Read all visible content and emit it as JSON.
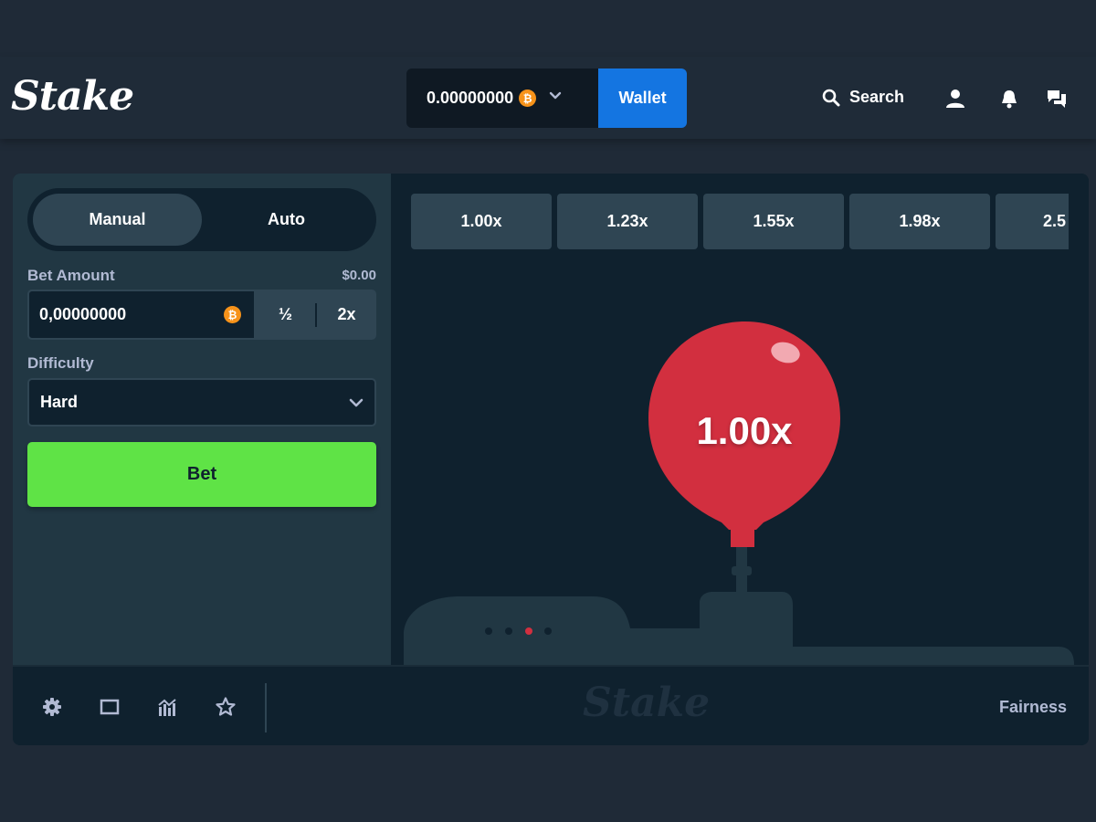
{
  "header": {
    "logo": "Stake",
    "balance": "0.00000000",
    "btc_symbol": "₿",
    "wallet_label": "Wallet",
    "search_label": "Search"
  },
  "sidebar": {
    "tabs": [
      {
        "label": "Manual",
        "active": true
      },
      {
        "label": "Auto",
        "active": false
      }
    ],
    "bet_amount_label": "Bet Amount",
    "bet_amount_usd": "$0.00",
    "bet_amount_value": "0,00000000",
    "half_label": "½",
    "double_label": "2x",
    "difficulty_label": "Difficulty",
    "difficulty_value": "Hard",
    "bet_button_label": "Bet"
  },
  "stage": {
    "multipliers": [
      "1.00x",
      "1.23x",
      "1.55x",
      "1.98x",
      "2.5"
    ],
    "balloon_value": "1.00x",
    "dots_active_index": 2
  },
  "footer": {
    "logo": "Stake",
    "fairness_label": "Fairness"
  },
  "colors": {
    "accent_blue": "#1475e1",
    "bet_green": "#5fe346",
    "balloon_red": "#d22f3f",
    "bitcoin_orange": "#f7931a"
  }
}
